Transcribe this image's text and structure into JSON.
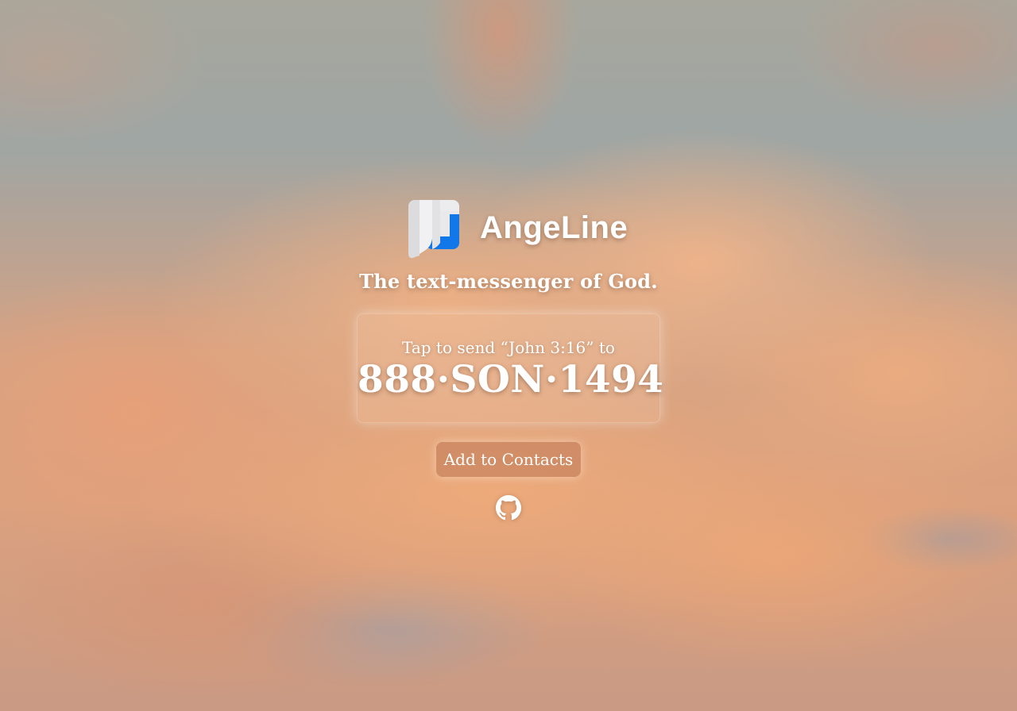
{
  "app": {
    "name": "AngeLine",
    "tagline": "The text-messenger of God."
  },
  "sms_card": {
    "prompt": "Tap to send “John 3:16” to",
    "phone_number": "888·SON·1494"
  },
  "actions": {
    "add_contacts_label": "Add to Contacts"
  },
  "icons": {
    "logo": "angeline-logo-icon",
    "github": "github-icon"
  },
  "colors": {
    "logo_blue": "#1277e8",
    "logo_gray": "#e6e6e8",
    "text": "#ffffff"
  }
}
